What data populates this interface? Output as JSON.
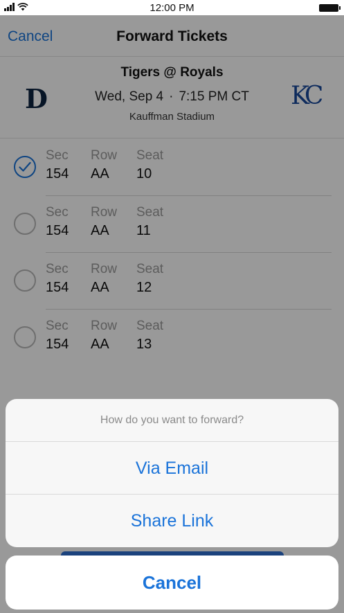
{
  "status_bar": {
    "time": "12:00 PM"
  },
  "nav": {
    "cancel_label": "Cancel",
    "title": "Forward Tickets"
  },
  "game": {
    "title": "Tigers @ Royals",
    "date": "Wed, Sep 4",
    "separator": "·",
    "time": "7:15 PM CT",
    "venue": "Kauffman Stadium",
    "home_logo_text": "KC",
    "away_logo_text": "D"
  },
  "labels": {
    "sec": "Sec",
    "row": "Row",
    "seat": "Seat"
  },
  "seats": [
    {
      "sec": "154",
      "row": "AA",
      "seat": "10",
      "selected": true
    },
    {
      "sec": "154",
      "row": "AA",
      "seat": "11",
      "selected": false
    },
    {
      "sec": "154",
      "row": "AA",
      "seat": "12",
      "selected": false
    },
    {
      "sec": "154",
      "row": "AA",
      "seat": "13",
      "selected": false
    }
  ],
  "action_sheet": {
    "title": "How do you want to forward?",
    "options": [
      "Via Email",
      "Share Link"
    ],
    "cancel_label": "Cancel"
  },
  "colors": {
    "accent": "#1a73d9",
    "overlay": "rgba(0,0,0,0.40)"
  }
}
